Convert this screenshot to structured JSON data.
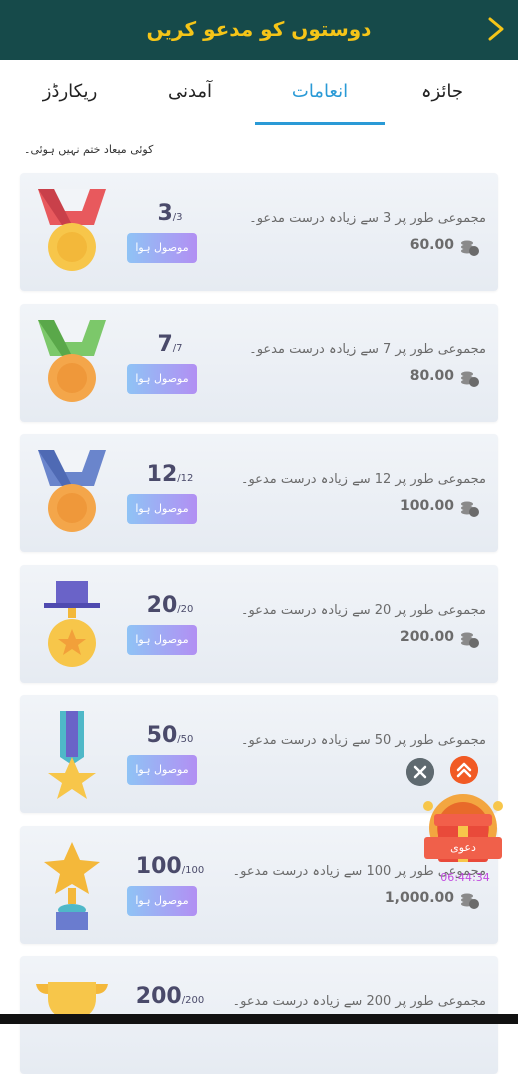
{
  "header": {
    "title": "دوستوں کو مدعو کریں"
  },
  "tabs": [
    {
      "label": "جائزہ"
    },
    {
      "label": "انعامات"
    },
    {
      "label": "آمدنی"
    },
    {
      "label": "ریکارڈز"
    }
  ],
  "active_tab": "انعامات",
  "notice": "کوئی میعاد ختم نہیں ہوئی۔",
  "cards": [
    {
      "count": "3",
      "total": "/3",
      "status": "موصول ہوا",
      "desc": "مجموعی طور پر 3 سے زیادہ درست مدعو۔",
      "reward": "60.00"
    },
    {
      "count": "7",
      "total": "/7",
      "status": "موصول ہوا",
      "desc": "مجموعی طور پر 7 سے زیادہ درست مدعو۔",
      "reward": "80.00"
    },
    {
      "count": "12",
      "total": "/12",
      "status": "موصول ہوا",
      "desc": "مجموعی طور پر 12 سے زیادہ درست مدعو۔",
      "reward": "100.00"
    },
    {
      "count": "20",
      "total": "/20",
      "status": "موصول ہوا",
      "desc": "مجموعی طور پر 20 سے زیادہ درست مدعو۔",
      "reward": "200.00"
    },
    {
      "count": "50",
      "total": "/50",
      "status": "موصول ہوا",
      "desc": "مجموعی طور پر 50 سے زیادہ درست مدعو۔",
      "reward": ""
    },
    {
      "count": "100",
      "total": "/100",
      "status": "موصول ہوا",
      "desc": "مجموعی طور پر 100 سے زیادہ درست مدعو۔",
      "reward": "1,000.00"
    },
    {
      "count": "200",
      "total": "/200",
      "status": "",
      "desc": "مجموعی طور پر 200 سے زیادہ درست مدعو۔",
      "reward": ""
    }
  ],
  "float": {
    "gift_label": "دعوی",
    "timer": "06:44:34"
  },
  "colors": {
    "header_bg": "#164a4a",
    "title": "#f5c518",
    "accent": "#2a9ad6"
  }
}
